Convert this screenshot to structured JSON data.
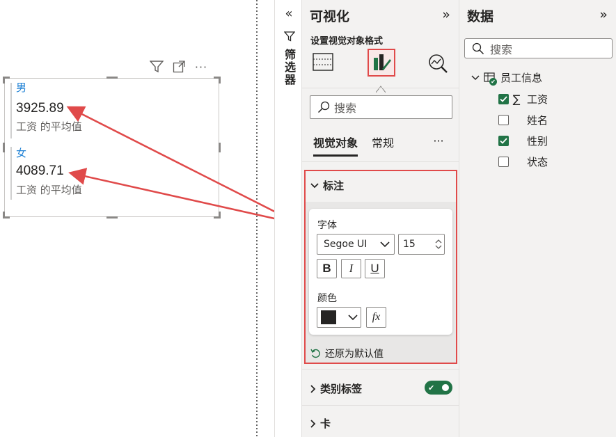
{
  "canvas": {
    "cards": [
      {
        "category": "男",
        "value": "3925.89",
        "subtitle": "工资 的平均值"
      },
      {
        "category": "女",
        "value": "4089.71",
        "subtitle": "工资 的平均值"
      }
    ]
  },
  "filter_pane": {
    "label": "筛选器"
  },
  "viz_pane": {
    "title": "可视化",
    "subtitle": "设置视觉对象格式",
    "search_placeholder": "搜索",
    "tabs": [
      "视觉对象",
      "常规"
    ],
    "sections": {
      "callout": "标注",
      "category_label": "类别标签",
      "card": "卡"
    },
    "font_label": "字体",
    "font_family": "Segoe UI",
    "font_size": "15",
    "bold": "B",
    "italic": "I",
    "underline": "U",
    "color_label": "颜色",
    "fx": "fx",
    "reset_label": "还原为默认值",
    "category_label_toggle": true
  },
  "data_pane": {
    "title": "数据",
    "search_placeholder": "搜索",
    "table_name": "员工信息",
    "fields": [
      {
        "name": "工资",
        "checked": true,
        "sigma": "∑"
      },
      {
        "name": "姓名",
        "checked": false,
        "sigma": ""
      },
      {
        "name": "性别",
        "checked": true,
        "sigma": ""
      },
      {
        "name": "状态",
        "checked": false,
        "sigma": ""
      }
    ]
  },
  "colors": {
    "accent_green": "#217346",
    "annotation_red": "#e04a4a",
    "category_blue": "#1b7fd4"
  }
}
